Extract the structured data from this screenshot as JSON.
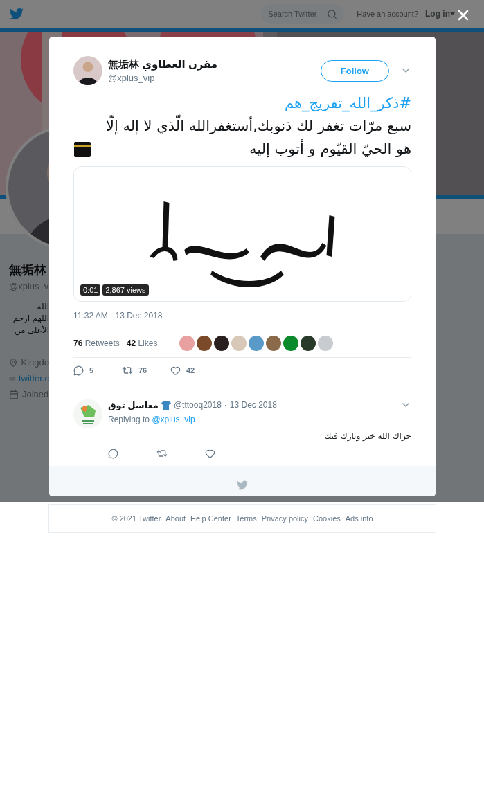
{
  "top_bar": {
    "search": {
      "placeholder": "Search Twitter"
    },
    "account_prompt": "Have an account?",
    "login": "Log in"
  },
  "profile": {
    "name": "無垢林",
    "handle": "@xplus_vi",
    "bio_lines": [
      "الله",
      "اللهم ارحم",
      "الأعلى من"
    ],
    "details": [
      {
        "kind": "location",
        "text": "Kingdo"
      },
      {
        "kind": "link",
        "text": "twitter.c"
      },
      {
        "kind": "joined",
        "text": "Joined"
      }
    ]
  },
  "tweet": {
    "author": {
      "name": "無垢林 مقرن العطاوي",
      "handle": "@xplus_vip"
    },
    "follow": "Follow",
    "hashtag": "#ذكر_الله_تفريج_هم",
    "text": "سبع مرّات تغفر لك ذنوبك,أستغفرالله الّذي لا إله إلّا هو الحيّ القيّوم و أتوب إليه",
    "video": {
      "duration": "0:01",
      "views": "2,867 views"
    },
    "timestamp": "11:32 AM - 13 Dec 2018",
    "stats": [
      {
        "count": "76",
        "label": "Retweets"
      },
      {
        "count": "42",
        "label": "Likes"
      }
    ],
    "likers": [
      {
        "color": "#e8a0a0"
      },
      {
        "color": "#7a4a2a"
      },
      {
        "color": "#2a2020"
      },
      {
        "color": "#d8c8b8"
      },
      {
        "color": "#5a9ac8"
      },
      {
        "color": "#8a6a4a"
      },
      {
        "color": "#0a8a2a"
      },
      {
        "color": "#2a3a2a"
      },
      {
        "color": "#c8ccd0"
      }
    ],
    "actions": [
      {
        "kind": "reply",
        "count": "5"
      },
      {
        "kind": "retweet",
        "count": "76"
      },
      {
        "kind": "like",
        "count": "42"
      }
    ]
  },
  "replies": [
    {
      "name": "مغاسل توق",
      "handle": "@tttooq2018",
      "separator": "·",
      "date": "13 Dec 2018",
      "replying_label": "Replying to",
      "replying_to": "@xplus_vip",
      "text": "جزاك الله خير وبارك فيك",
      "actions": [
        {
          "kind": "reply"
        },
        {
          "kind": "retweet"
        },
        {
          "kind": "like"
        }
      ]
    }
  ],
  "footer": [
    "© 2021 Twitter",
    "About",
    "Help Center",
    "Terms",
    "Privacy policy",
    "Cookies",
    "Ads info"
  ]
}
